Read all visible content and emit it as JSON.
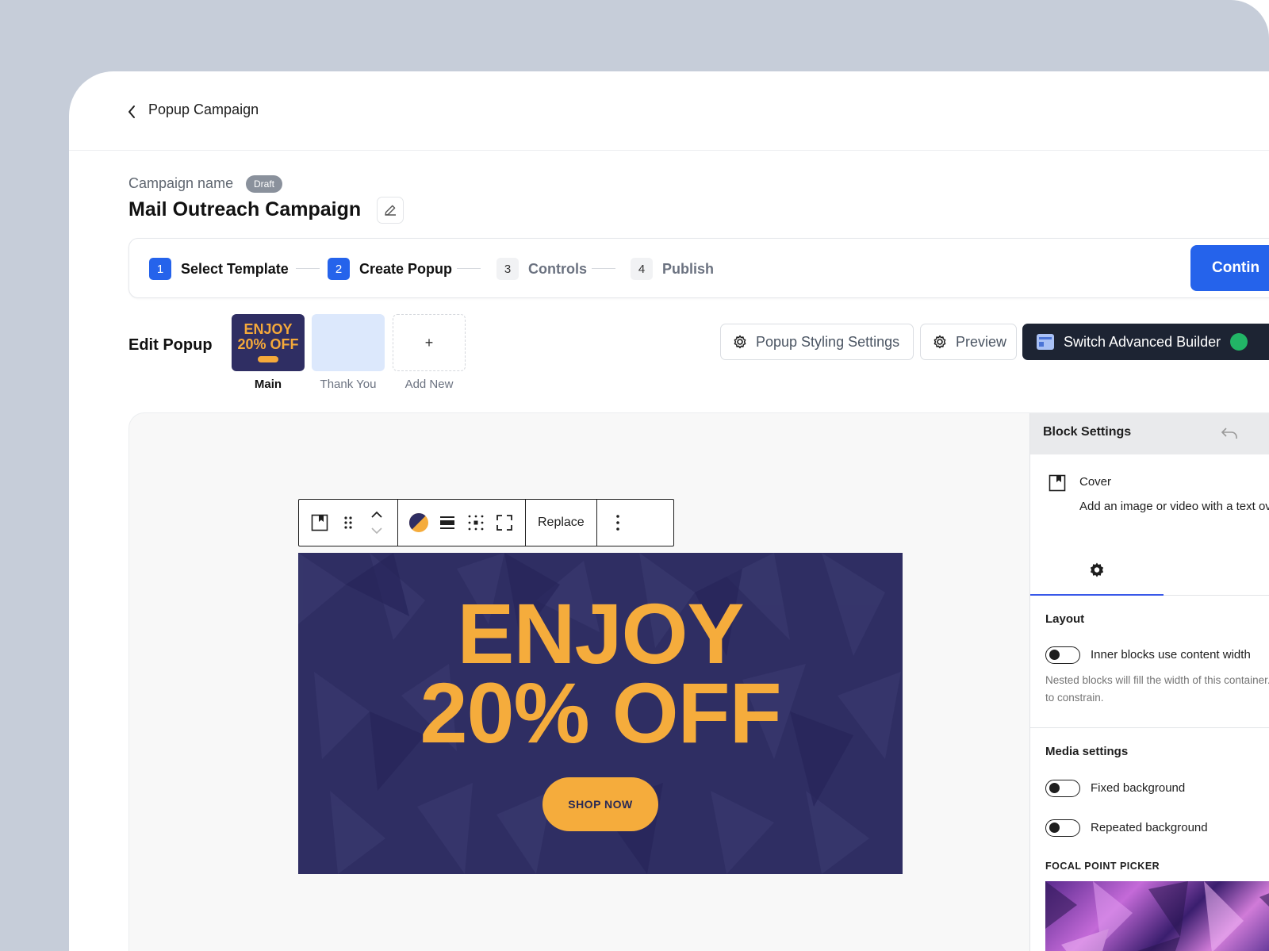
{
  "header": {
    "title": "Popup Campaign"
  },
  "campaign": {
    "label": "Campaign name",
    "status_badge": "Draft",
    "title": "Mail Outreach Campaign"
  },
  "stepper": {
    "steps": [
      {
        "num": "1",
        "label": "Select Template",
        "state": "complete"
      },
      {
        "num": "2",
        "label": "Create Popup",
        "state": "active"
      },
      {
        "num": "3",
        "label": "Controls",
        "state": "inactive"
      },
      {
        "num": "4",
        "label": "Publish",
        "state": "inactive"
      }
    ],
    "continue_label": "Contin"
  },
  "edit_popup": {
    "label": "Edit Popup",
    "screens": [
      {
        "caption": "Main",
        "thumb_line1": "ENJOY",
        "thumb_line2": "20% OFF"
      },
      {
        "caption": "Thank You"
      },
      {
        "caption": "Add New",
        "add_symbol": "+"
      }
    ],
    "styling_button": "Popup Styling Settings",
    "preview_button": "Preview",
    "advanced_button": "Switch Advanced Builder"
  },
  "block_toolbar": {
    "replace_label": "Replace"
  },
  "cover_block": {
    "line1": "ENJOY",
    "line2": "20% OFF",
    "button_label": "SHOP NOW"
  },
  "panel": {
    "title": "Block Settings",
    "block_name": "Cover",
    "block_description": "Add an image or video with a text overlay.",
    "layout": {
      "title": "Layout",
      "toggle_label": "Inner blocks use content width",
      "help": "Nested blocks will fill the width of this container. Toggle to constrain."
    },
    "media": {
      "title": "Media settings",
      "fixed_label": "Fixed background",
      "repeated_label": "Repeated background",
      "focal_label": "FOCAL POINT PICKER"
    }
  },
  "colors": {
    "accent": "#2563eb",
    "cover_bg": "#2f2e63",
    "cover_text": "#f5ac3c",
    "dark_button": "#1d2433"
  },
  "icons": {
    "back": "chevron-left-icon",
    "edit": "pencil-icon",
    "styling": "gear-icon",
    "preview": "gear-icon",
    "advanced": "layout-icon"
  }
}
